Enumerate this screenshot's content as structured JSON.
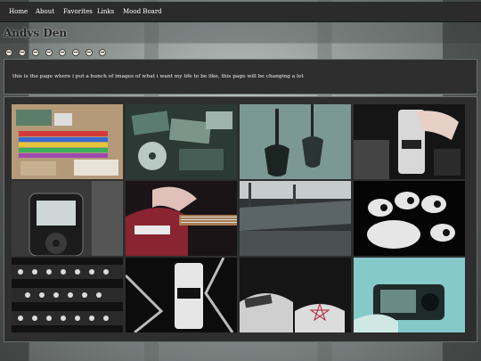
{
  "nav": {
    "items": [
      {
        "label": "Home"
      },
      {
        "label": "About"
      },
      {
        "label": "Favorites"
      },
      {
        "label": "Links"
      },
      {
        "label": "Mood Board"
      }
    ]
  },
  "site": {
    "title": "Andys Den"
  },
  "intro": {
    "text": "this is the page where i put a bunch of images of what i want my life to be like, this page will be changing a lot"
  },
  "gallery": {
    "images": [
      {
        "subject": "art-supplies"
      },
      {
        "subject": "cd-stack"
      },
      {
        "subject": "guitar-wall"
      },
      {
        "subject": "energy-drink-can"
      },
      {
        "subject": "ipod"
      },
      {
        "subject": "electric-guitar"
      },
      {
        "subject": "abandoned-rooftop"
      },
      {
        "subject": "gloved-hand"
      },
      {
        "subject": "studded-bracelets"
      },
      {
        "subject": "monster-can-chains"
      },
      {
        "subject": "sneakers-pentagram"
      },
      {
        "subject": "camera-in-hand"
      }
    ]
  },
  "colors": {
    "navbar": "#2b2b2b",
    "panel": "#2e2e2e",
    "panel_border": "#6e6e6e",
    "text_light": "#ffffff"
  }
}
